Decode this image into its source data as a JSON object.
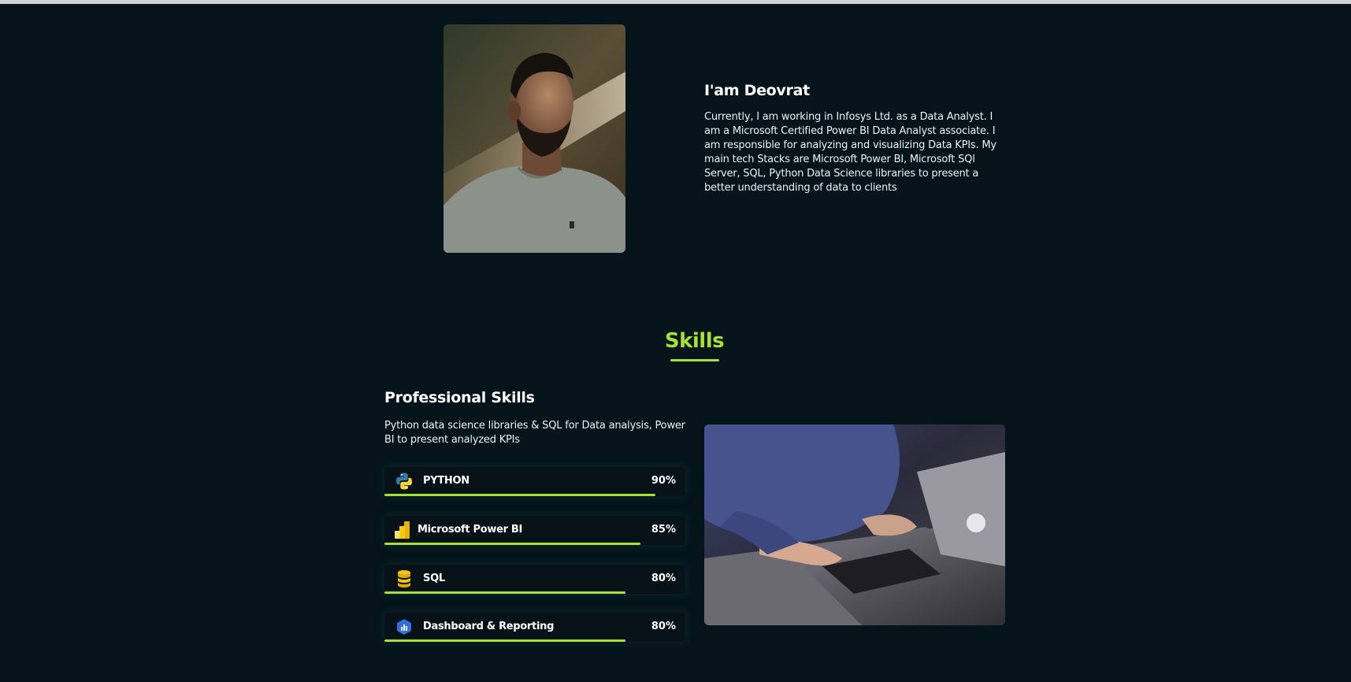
{
  "about": {
    "title": "I'am Deovrat",
    "text": "Currently, I am working in Infosys Ltd. as a Data Analyst. I am a Microsoft Certified Power BI Data Analyst associate. I am responsible for analyzing and visualizing Data KPIs. My main tech Stacks are Microsoft Power BI, Microsoft SQl Server, SQL, Python Data Science libraries to present a better understanding of data to clients"
  },
  "skills": {
    "title": "Skills",
    "pro_title": "Professional Skills",
    "pro_text": "Python data science libraries & SQL for Data analysis, Power BI to present analyzed KPIs",
    "items": [
      {
        "name": "PYTHON",
        "percent": "90%",
        "value": 0.9,
        "icon": "python-icon"
      },
      {
        "name": "Microsoft Power BI",
        "percent": "85%",
        "value": 0.85,
        "icon": "power-bi-icon"
      },
      {
        "name": "SQL",
        "percent": "80%",
        "value": 0.8,
        "icon": "database-icon"
      },
      {
        "name": "Dashboard & Reporting",
        "percent": "80%",
        "value": 0.8,
        "icon": "dashboard-icon"
      }
    ]
  },
  "colors": {
    "accent": "#a5e233",
    "background": "#04141a"
  }
}
